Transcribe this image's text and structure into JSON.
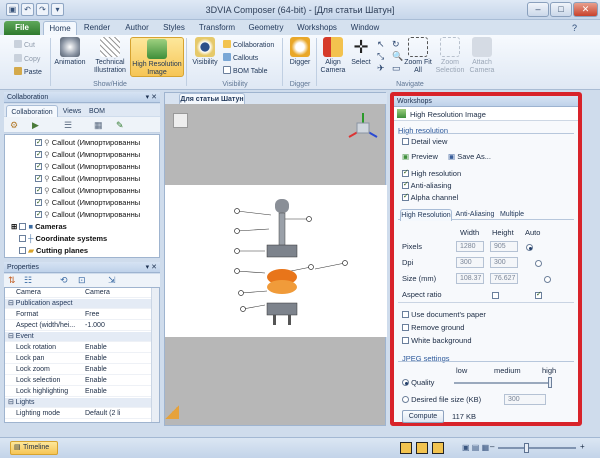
{
  "window": {
    "title": "3DVIA Composer (64-bit) - [Для статьи Шатун]",
    "min": "–",
    "max": "□",
    "close": "✕"
  },
  "tabs": [
    "File",
    "Home",
    "Render",
    "Author",
    "Styles",
    "Transform",
    "Geometry",
    "Workshops",
    "Window"
  ],
  "ribbon": {
    "cut": "Cut",
    "copy": "Copy",
    "paste": "Paste",
    "animation": "Animation",
    "technical": "Technical Illustration",
    "hires": "High Resolution Image",
    "showhide": "Show/Hide",
    "visibility": "Visibility",
    "collaboration": "Collaboration",
    "callouts": "Callouts",
    "bom_table": "BOM Table",
    "visibility_group": "Visibility",
    "digger": "Digger",
    "digger2": "Digger",
    "align_camera": "Align Camera",
    "select": "Select",
    "zoom_fit": "Zoom Fit All",
    "zoom_sel": "Zoom Selection",
    "attach_camera": "Attach Camera",
    "navigate": "Navigate"
  },
  "collab": {
    "header": "Collaboration",
    "tabs": [
      "Collaboration",
      "Views",
      "BOM"
    ],
    "items": [
      "Callout (Импортированны",
      "Callout (Импортированны",
      "Callout (Импортированны",
      "Callout (Импортированны",
      "Callout (Импортированны",
      "Callout (Импортированны",
      "Callout (Импортированны"
    ],
    "cameras": "Cameras",
    "coord": "Coordinate systems",
    "planes": "Cutting planes"
  },
  "props": {
    "header": "Properties",
    "rows": [
      {
        "k": "Camera",
        "v": "Camera",
        "s": false
      },
      {
        "k": "Publication aspect",
        "v": "",
        "s": true
      },
      {
        "k": "Format",
        "v": "Free",
        "s": false
      },
      {
        "k": "Aspect (width/hei...",
        "v": "-1.000",
        "s": false
      },
      {
        "k": "Event",
        "v": "",
        "s": true
      },
      {
        "k": "Lock rotation",
        "v": "Enable",
        "s": false
      },
      {
        "k": "Lock pan",
        "v": "Enable",
        "s": false
      },
      {
        "k": "Lock zoom",
        "v": "Enable",
        "s": false
      },
      {
        "k": "Lock selection",
        "v": "Enable",
        "s": false
      },
      {
        "k": "Lock highlighting",
        "v": "Enable",
        "s": false
      },
      {
        "k": "Lights",
        "v": "",
        "s": true
      },
      {
        "k": "Lighting mode",
        "v": "Default (2 li",
        "s": false
      }
    ]
  },
  "viewport": {
    "tab": "Для статьи Шатун"
  },
  "workshop": {
    "header": "Workshops",
    "title": "High Resolution Image",
    "section": "High resolution",
    "detail": "Detail view",
    "preview": "Preview",
    "save": "Save As...",
    "opt_hires": "High resolution",
    "opt_aa": "Anti-aliasing",
    "opt_alpha": "Alpha channel",
    "subtabs": [
      "High Resolution",
      "Anti-Aliasing",
      "Multiple"
    ],
    "col_width": "Width",
    "col_height": "Height",
    "col_auto": "Auto",
    "pixels": "Pixels",
    "pixels_w": "1280",
    "pixels_h": "905",
    "dpi": "Dpi",
    "dpi_w": "300",
    "dpi_h": "300",
    "size": "Size (mm)",
    "size_w": "108.37",
    "size_h": "76.627",
    "aspect": "Aspect ratio",
    "doc_paper": "Use document's paper",
    "remove_ground": "Remove ground",
    "white_bg": "White background",
    "jpeg": "JPEG settings",
    "low": "low",
    "medium": "medium",
    "high": "high",
    "quality": "Quality",
    "desired": "Desired file size (KB)",
    "desired_val": "300",
    "compute": "Compute",
    "compute_res": "117 KB",
    "quality_level": 1.0
  },
  "statusbar": {
    "timeline": "Timeline"
  }
}
